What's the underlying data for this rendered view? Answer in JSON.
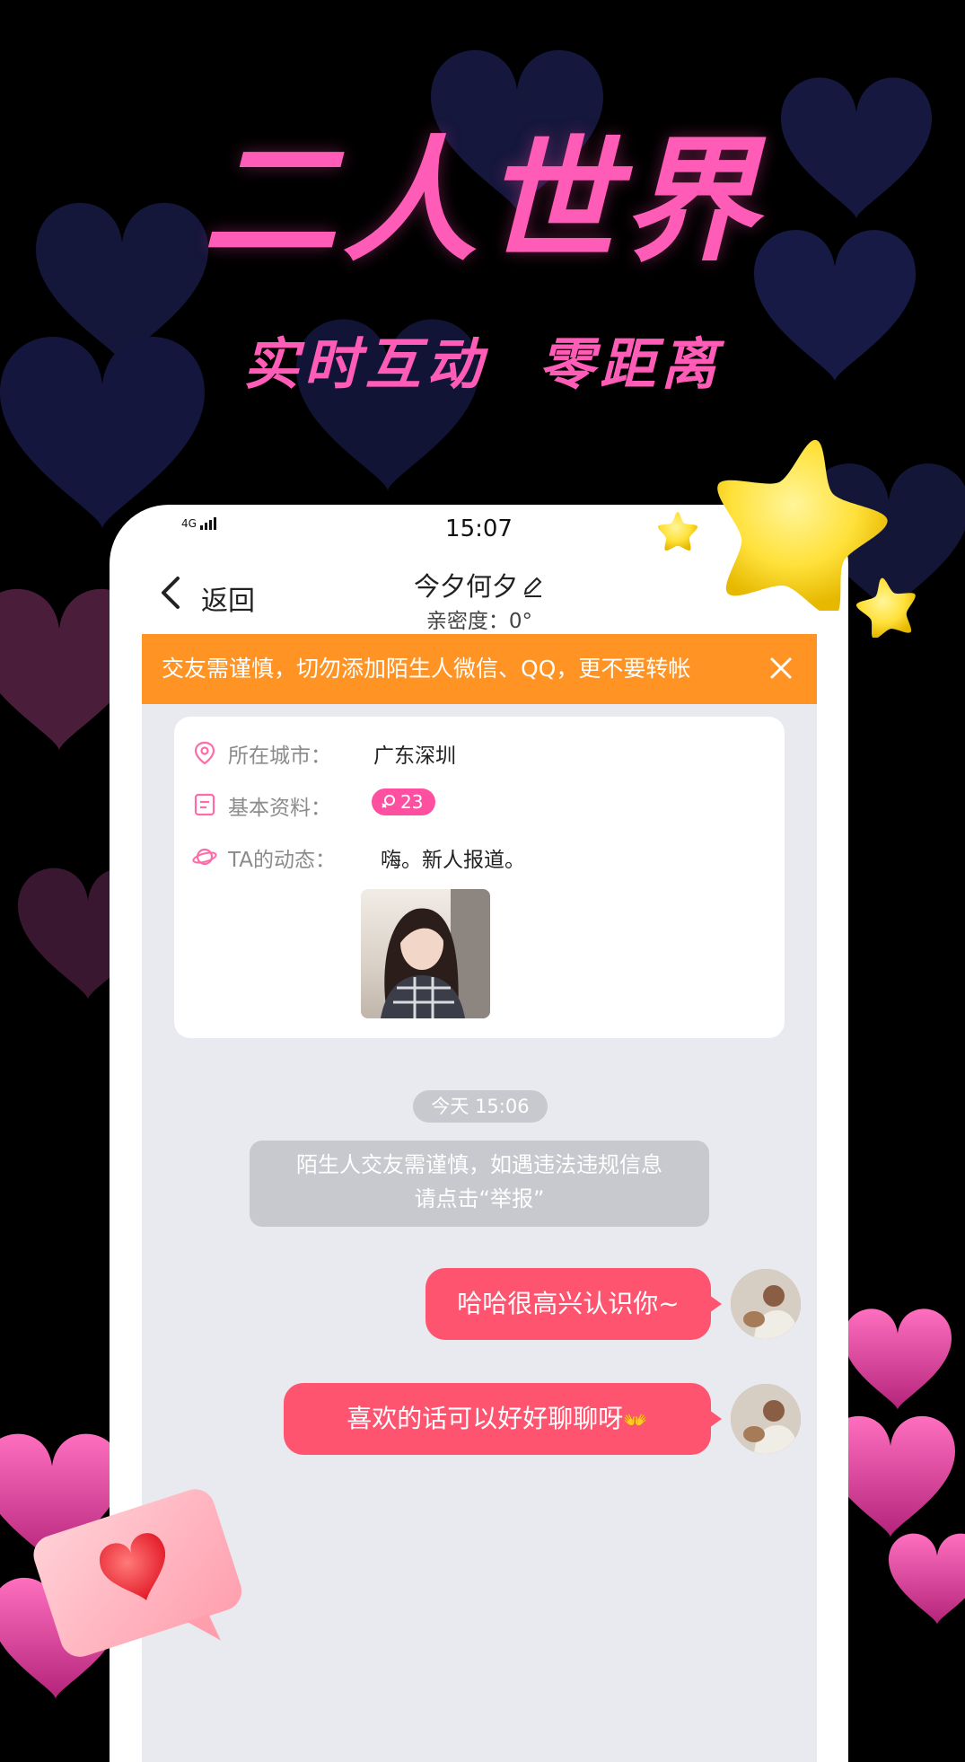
{
  "hero": {
    "title": "二人世界",
    "subtitle": "实时互动  零距离"
  },
  "status_bar": {
    "network": "4G",
    "time": "15:07"
  },
  "nav": {
    "back_label": "返回",
    "contact_name": "今夕何夕",
    "intimacy": "亲密度：0°"
  },
  "notice": {
    "text": "交友需谨慎，切勿添加陌生人微信、QQ，更不要转帐",
    "close_icon": "close-icon"
  },
  "profile": {
    "city_label": "所在城市：",
    "city_value": "广东深圳",
    "basic_label": "基本资料：",
    "age": "23",
    "moments_label": "TA的动态：",
    "moments_value": "嗨。新人报道。"
  },
  "chat": {
    "timestamp": "今天 15:06",
    "system_line1": "陌生人交友需谨慎，如遇违法违规信息",
    "system_line2": "请点击“举报”",
    "messages": [
      {
        "text": "哈哈很高兴认识你~",
        "sender": "me"
      },
      {
        "text": "喜欢的话可以好好聊聊呀",
        "sender": "me",
        "emoji": "👐"
      }
    ]
  },
  "colors": {
    "accent_pink": "#ff5cb8",
    "bubble": "#ff5470",
    "notice": "#ff9324",
    "badge": "#ff4fa0"
  }
}
